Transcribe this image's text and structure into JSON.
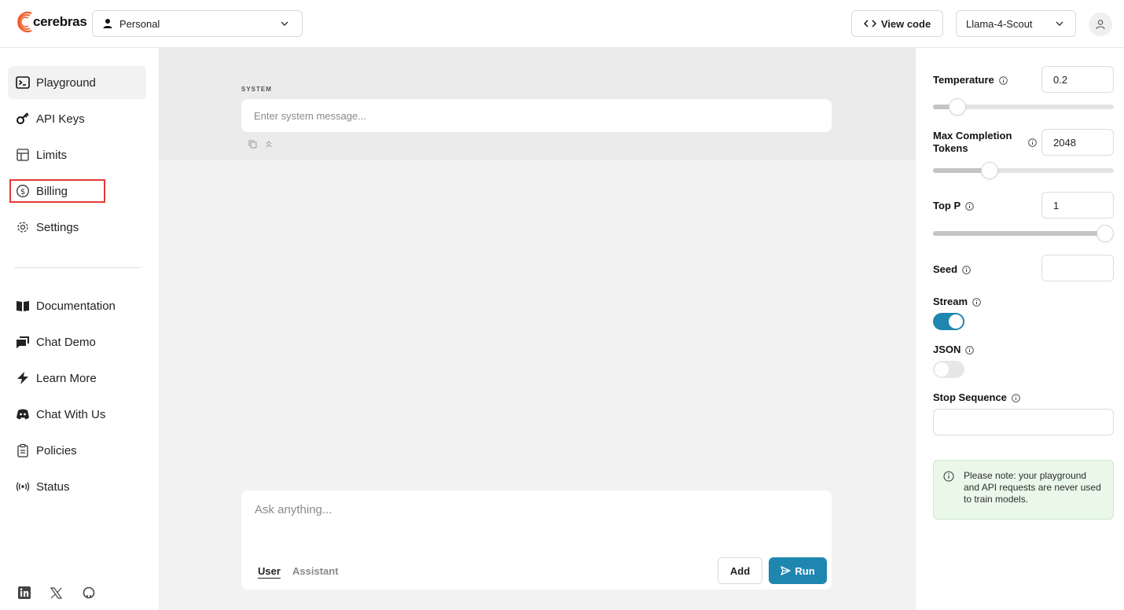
{
  "header": {
    "logo_text": "cerebras",
    "org_select_value": "Personal",
    "view_code_label": "View code",
    "model_select_value": "Llama-4-Scout"
  },
  "sidebar": {
    "items": [
      {
        "label": "Playground",
        "icon": "terminal-icon",
        "active": true
      },
      {
        "label": "API Keys",
        "icon": "key-icon"
      },
      {
        "label": "Limits",
        "icon": "table-icon"
      },
      {
        "label": "Billing",
        "icon": "dollar-circle-icon"
      },
      {
        "label": "Settings",
        "icon": "gear-icon"
      }
    ],
    "secondary_items": [
      {
        "label": "Documentation",
        "icon": "book-icon"
      },
      {
        "label": "Chat Demo",
        "icon": "chat-bubbles-icon"
      },
      {
        "label": "Learn More",
        "icon": "bolt-icon"
      },
      {
        "label": "Chat With Us",
        "icon": "discord-icon"
      },
      {
        "label": "Policies",
        "icon": "clipboard-icon"
      },
      {
        "label": "Status",
        "icon": "broadcast-icon"
      }
    ],
    "social": [
      "linkedin-icon",
      "x-icon",
      "github-icon"
    ]
  },
  "main": {
    "system_label": "SYSTEM",
    "system_placeholder": "Enter system message...",
    "chat_placeholder": "Ask anything...",
    "role_user": "User",
    "role_assistant": "Assistant",
    "add_label": "Add",
    "run_label": "Run"
  },
  "panel": {
    "temperature": {
      "label": "Temperature",
      "value": "0.2",
      "fraction": 0.1
    },
    "max_tokens": {
      "label": "Max Completion Tokens",
      "label_line1": "Max Completion",
      "label_line2": "Tokens",
      "value": "2048",
      "fraction": 0.28
    },
    "top_p": {
      "label": "Top P",
      "value": "1",
      "fraction": 1.0
    },
    "seed": {
      "label": "Seed",
      "value": ""
    },
    "stream": {
      "label": "Stream",
      "on": true
    },
    "json": {
      "label": "JSON",
      "on": false
    },
    "stop_sequence": {
      "label": "Stop Sequence",
      "value": ""
    },
    "note": "Please note: your playground and API requests are never used to train models."
  },
  "colors": {
    "accent": "#1f86b0",
    "highlight_box": "#e53935",
    "logo_orange": "#f15a24"
  }
}
